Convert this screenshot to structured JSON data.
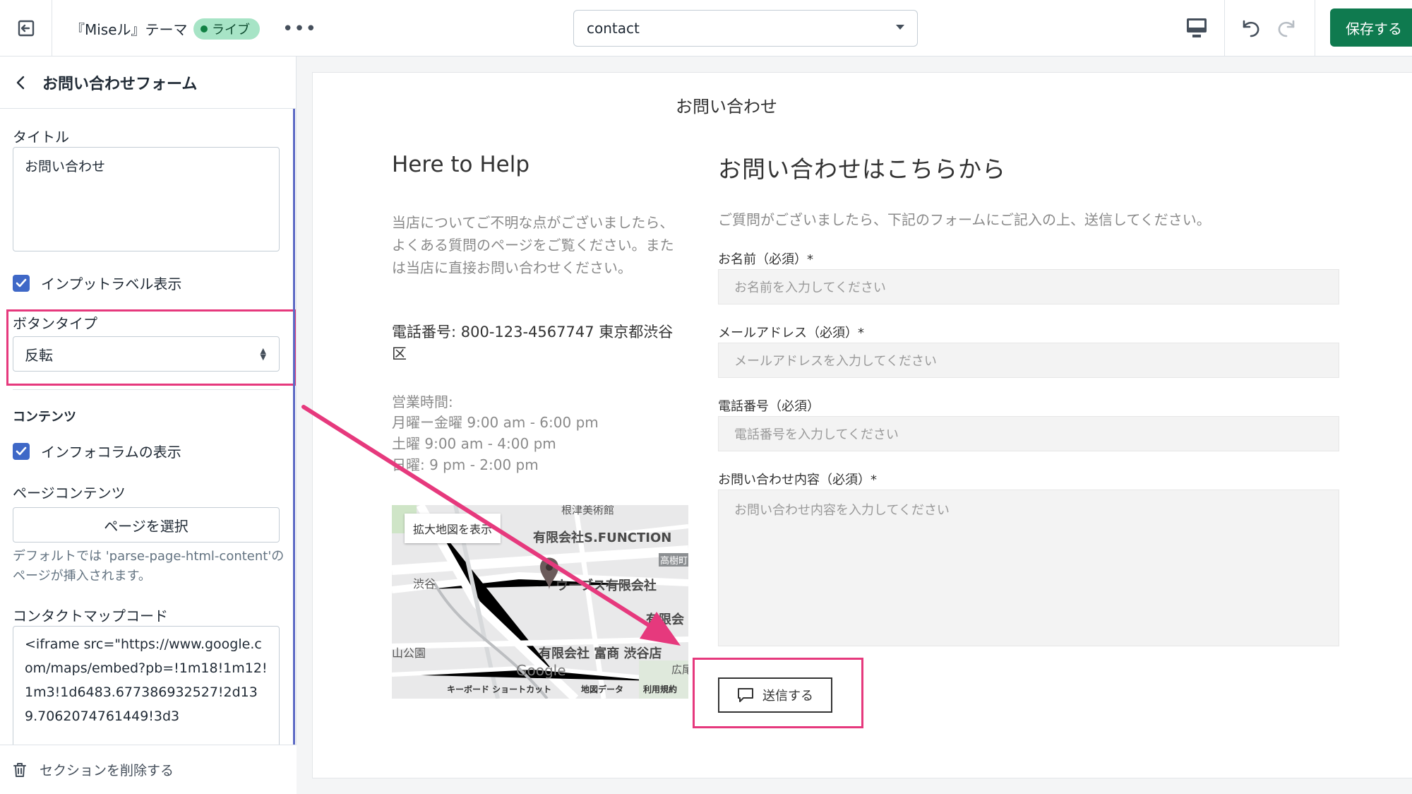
{
  "topbar": {
    "theme_name": "『Miseル』テーマ",
    "live_label": "ライブ",
    "more_label": "•••",
    "page_select_value": "contact",
    "save_label": "保存する"
  },
  "sidebar": {
    "header_title": "お問い合わせフォーム",
    "title_label": "タイトル",
    "title_value": "お問い合わせ",
    "show_input_labels": "インプットラベル表示",
    "button_type_label": "ボタンタイプ",
    "button_type_value": "反転",
    "content_heading": "コンテンツ",
    "show_info_column": "インフォコラムの表示",
    "page_content_label": "ページコンテンツ",
    "select_page_button": "ページを選択",
    "page_content_help": "デフォルトでは 'parse-page-html-content'のページが挿入されます。",
    "map_code_label": "コンタクトマップコード",
    "map_code_value": "<iframe src=\"https://www.google.com/maps/embed?pb=!1m18!1m12!1m3!1d6483.677386932527!2d139.7062074761449!3d3",
    "delete_section": "セクションを削除する"
  },
  "preview": {
    "page_title": "お問い合わせ",
    "help_heading": "Here to Help",
    "help_text": "当店についてご不明な点がございましたら、よくある質問のページをご覧ください。または当店に直接お問い合わせください。",
    "phone": "電話番号: 800-123-4567747 東京都渋谷区",
    "hours_heading": "営業時間:",
    "hours": [
      "月曜ー金曜 9:00 am - 6:00 pm",
      "土曜 9:00 am - 4:00 pm",
      "日曜: 9 pm - 2:00 pm"
    ],
    "map": {
      "enlarge_button": "拡大地図を表示",
      "labels": [
        "有限会社S.FUNCTION",
        "ウーブス有限会社",
        "有限会",
        "有限会社 富商 渋谷店",
        "渋谷",
        "山公園",
        "根津美術館",
        "高樹町",
        "広尾",
        "Google"
      ],
      "footer": [
        "キーボード ショートカット",
        "地図データ",
        "利用規約"
      ]
    },
    "form_heading": "お問い合わせはこちらから",
    "form_intro": "ご質問がございましたら、下記のフォームにご記入の上、送信してください。",
    "fields": [
      {
        "label": "お名前（必須）*",
        "placeholder": "お名前を入力してください"
      },
      {
        "label": "メールアドレス（必須）*",
        "placeholder": "メールアドレスを入力してください"
      },
      {
        "label": "電話番号（必須）",
        "placeholder": "電話番号を入力してください"
      },
      {
        "label": "お問い合わせ内容（必須）*",
        "placeholder": "お問い合わせ内容を入力してください"
      }
    ],
    "send_button": "送信する"
  },
  "colors": {
    "save_green": "#0f7a4f",
    "highlight_pink": "#e6397d",
    "checkbox_blue": "#3f68c7",
    "live_badge": "#a7e4c6"
  }
}
